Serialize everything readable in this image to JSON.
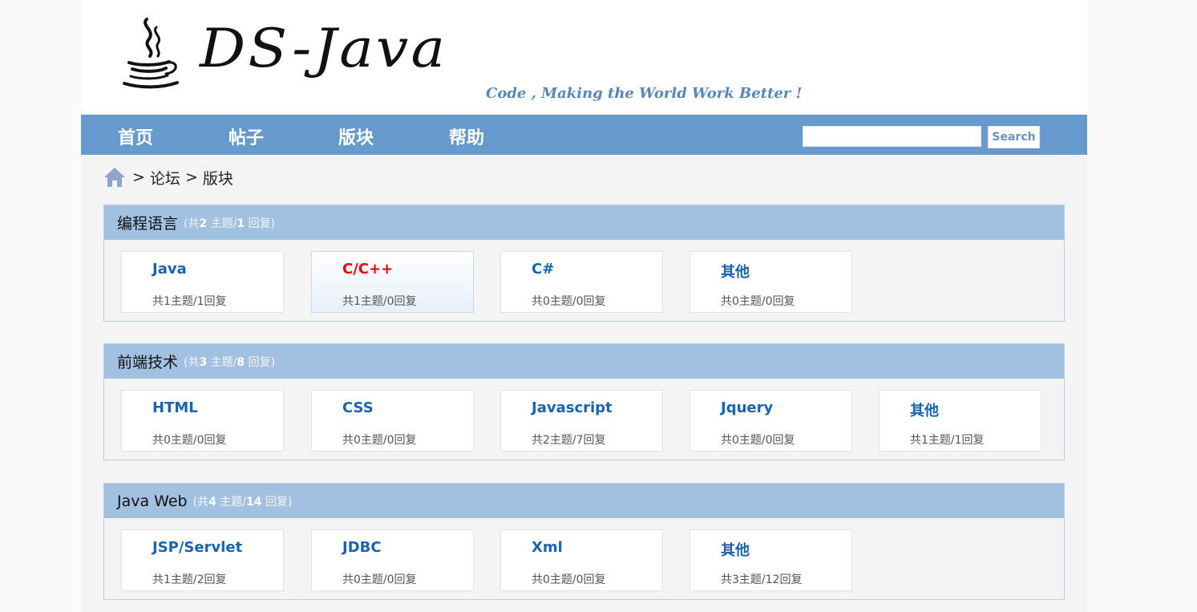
{
  "header": {
    "logo_text": "DS-Java",
    "slogan": "Code , Making the World Work Better !"
  },
  "nav": {
    "items": [
      {
        "label": "首页"
      },
      {
        "label": "帖子"
      },
      {
        "label": "版块"
      },
      {
        "label": "帮助"
      }
    ],
    "search_button": "Search",
    "search_value": ""
  },
  "breadcrumb": {
    "sep1": ">",
    "forum": "论坛",
    "sep2": ">",
    "board": "版块"
  },
  "sections": [
    {
      "title": "编程语言",
      "stats_open": "(共",
      "topics": "2",
      "topics_label": " 主题/",
      "replies": "1",
      "replies_label": " 回复)",
      "boards": [
        {
          "name": "Java",
          "stats": "共1主题/1回复"
        },
        {
          "name": "C/C++",
          "stats": "共1主题/0回复"
        },
        {
          "name": "C#",
          "stats": "共0主题/0回复"
        },
        {
          "name": "其他",
          "stats": "共0主题/0回复"
        }
      ]
    },
    {
      "title": "前端技术",
      "stats_open": "(共",
      "topics": "3",
      "topics_label": " 主题/",
      "replies": "8",
      "replies_label": " 回复)",
      "boards": [
        {
          "name": "HTML",
          "stats": "共0主题/0回复"
        },
        {
          "name": "CSS",
          "stats": "共0主题/0回复"
        },
        {
          "name": "Javascript",
          "stats": "共2主题/7回复"
        },
        {
          "name": "Jquery",
          "stats": "共0主题/0回复"
        },
        {
          "name": "其他",
          "stats": "共1主题/1回复"
        }
      ]
    },
    {
      "title": "Java Web",
      "stats_open": "(共",
      "topics": "4",
      "topics_label": " 主题/",
      "replies": "14",
      "replies_label": " 回复)",
      "boards": [
        {
          "name": "JSP/Servlet",
          "stats": "共1主题/2回复"
        },
        {
          "name": "JDBC",
          "stats": "共0主题/0回复"
        },
        {
          "name": "Xml",
          "stats": "共0主题/0回复"
        },
        {
          "name": "其他",
          "stats": "共3主题/12回复"
        }
      ]
    }
  ],
  "colors": {
    "nav_bg": "#6699cc",
    "section_header": "#a2c1e0",
    "link_blue": "#1a63b0",
    "active_red": "#e8000c"
  },
  "icons": {
    "logo": "java-cup-icon",
    "breadcrumb_home": "home-icon"
  },
  "active_board": "C/C++"
}
